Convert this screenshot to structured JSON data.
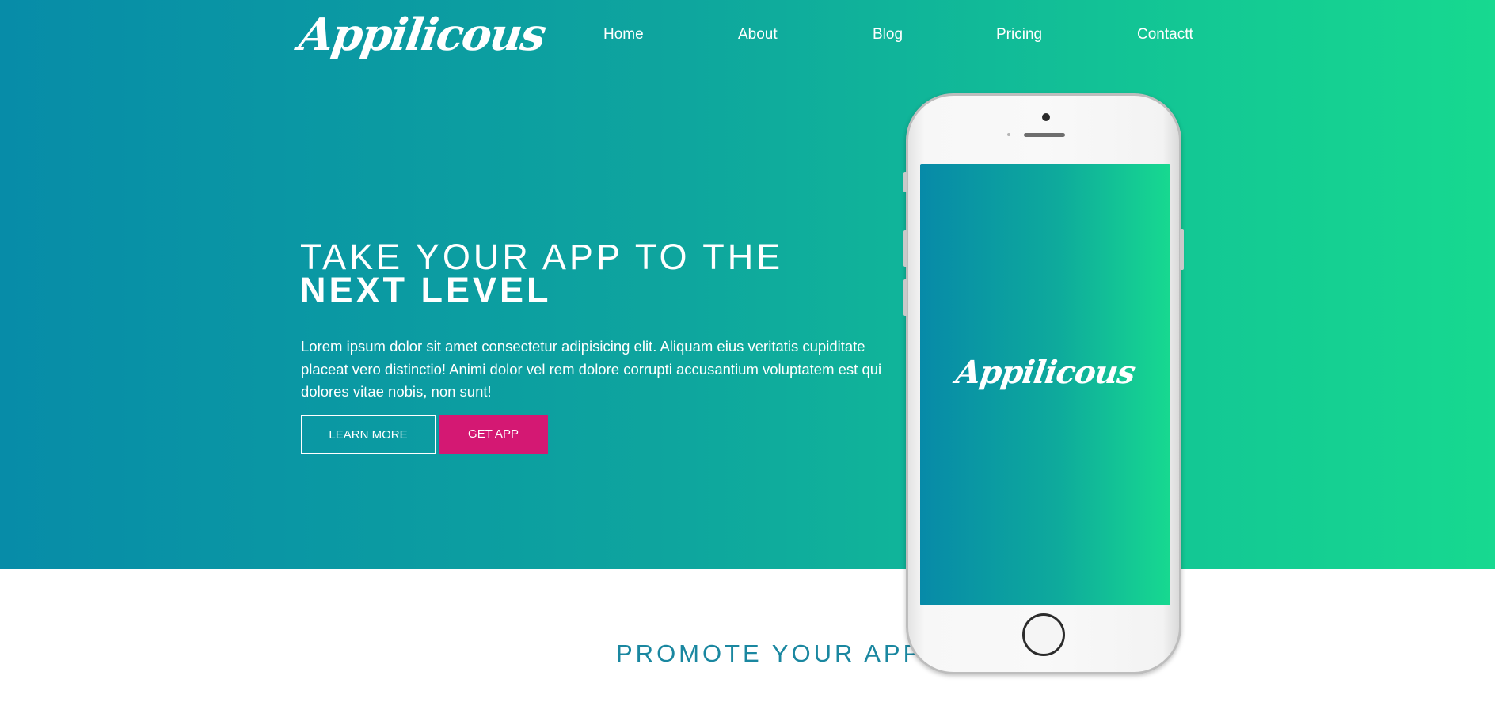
{
  "brand": {
    "logo_text": "Appilicous"
  },
  "nav": {
    "items": [
      {
        "label": "Home"
      },
      {
        "label": "About"
      },
      {
        "label": "Blog"
      },
      {
        "label": "Pricing"
      },
      {
        "label": "Contactt"
      }
    ]
  },
  "hero": {
    "headline_light": "TAKE YOUR APP TO THE ",
    "headline_bold": "NEXT LEVEL",
    "lead": "Lorem ipsum dolor sit amet consectetur adipisicing elit. Aliquam eius veritatis cupiditate placeat vero distinctio! Animi dolor vel rem dolore corrupti accusantium voluptatem est qui dolores vitae nobis, non sunt!",
    "learn_more_label": "LEARN MORE",
    "get_app_label": "GET APP"
  },
  "phone": {
    "screen_logo_text": "Appilicous"
  },
  "promote": {
    "title": "PROMOTE YOUR APP"
  },
  "colors": {
    "gradient_start": "#078ca8",
    "gradient_end": "#17d990",
    "accent_button": "#d41873",
    "promote_title": "#1a87a0"
  }
}
